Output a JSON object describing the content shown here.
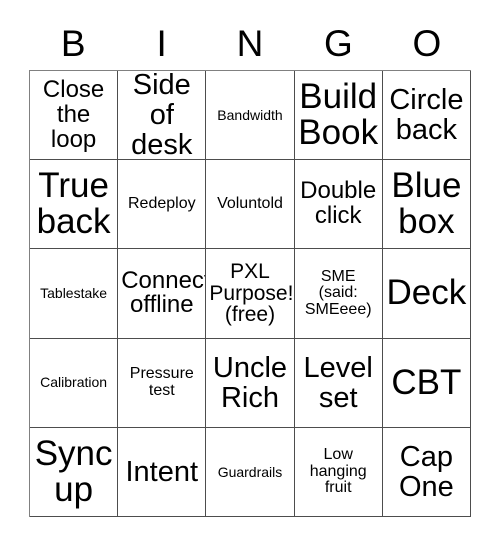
{
  "card": {
    "title_letters": [
      "B",
      "I",
      "N",
      "G",
      "O"
    ],
    "colors": {
      "background": "#ffffff",
      "text": "#000000",
      "grid_line": "#4d4d4d"
    },
    "free_space_label": "PXL Purpose! (free)",
    "cells": [
      {
        "text": "Close\nthe\nloop",
        "size": "md"
      },
      {
        "text": "Side of\ndesk",
        "size": "lg"
      },
      {
        "text": "Bandwidth",
        "size": "xxs"
      },
      {
        "text": "Build\nBook",
        "size": "xl"
      },
      {
        "text": "Circle\nback",
        "size": "lg"
      },
      {
        "text": "True\nback",
        "size": "xl"
      },
      {
        "text": "Redeploy",
        "size": "xs"
      },
      {
        "text": "Voluntold",
        "size": "xs"
      },
      {
        "text": "Double\nclick",
        "size": "md"
      },
      {
        "text": "Blue\nbox",
        "size": "xl"
      },
      {
        "text": "Tablestake",
        "size": "xxs"
      },
      {
        "text": "Connect\noffline",
        "size": "md"
      },
      {
        "text": "PXL\nPurpose!\n(free)",
        "size": "sm"
      },
      {
        "text": "SME\n(said:\nSMEeee)",
        "size": "xs"
      },
      {
        "text": "Deck",
        "size": "xl"
      },
      {
        "text": "Calibration",
        "size": "xxs"
      },
      {
        "text": "Pressure\ntest",
        "size": "xs"
      },
      {
        "text": "Uncle\nRich",
        "size": "lg"
      },
      {
        "text": "Level\nset",
        "size": "lg"
      },
      {
        "text": "CBT",
        "size": "xl"
      },
      {
        "text": "Sync\nup",
        "size": "xl"
      },
      {
        "text": "Intent",
        "size": "lg"
      },
      {
        "text": "Guardrails",
        "size": "xxs"
      },
      {
        "text": "Low\nhanging\nfruit",
        "size": "xs"
      },
      {
        "text": "Cap\nOne",
        "size": "lg"
      }
    ]
  }
}
